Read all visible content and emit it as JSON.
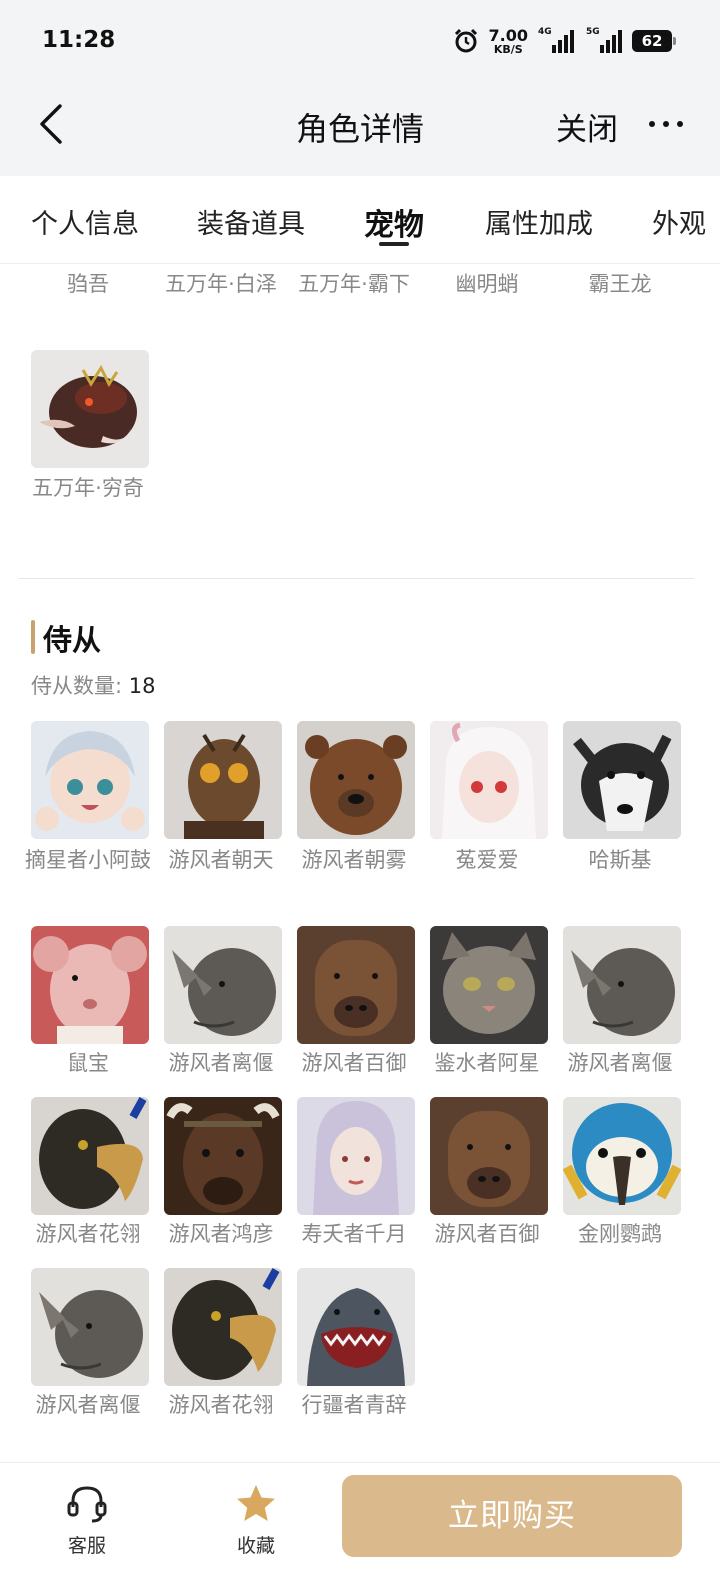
{
  "status_bar": {
    "time": "11:28",
    "net_speed": "7.00",
    "net_unit": "KB/S",
    "sim1": "4G",
    "sim2": "5G",
    "battery": "62"
  },
  "nav": {
    "title": "角色详情",
    "close": "关闭"
  },
  "tabs": [
    {
      "label": "个人信息"
    },
    {
      "label": "装备道具"
    },
    {
      "label": "宠物",
      "active": true
    },
    {
      "label": "属性加成"
    },
    {
      "label": "外观"
    }
  ],
  "pets": {
    "top_row": [
      "驺吾",
      "五万年·白泽",
      "五万年·霸下",
      "幽明蛸",
      "霸王龙"
    ],
    "last": {
      "name": "五万年·穷奇",
      "icon": "qiongqi-avatar"
    }
  },
  "servants": {
    "title": "侍从",
    "count_label": "侍从数量:",
    "count": "18",
    "items": [
      {
        "name": "摘星者小阿鼓",
        "icon": "chibi-girl-avatar",
        "color": "#cfd8e4"
      },
      {
        "name": "游风者朝天",
        "icon": "insect-man-avatar",
        "color": "#6b4a2e"
      },
      {
        "name": "游风者朝雾",
        "icon": "bear-avatar",
        "color": "#7a4a2a"
      },
      {
        "name": "菟爱爱",
        "icon": "white-hair-girl-avatar",
        "color": "#f1ecee"
      },
      {
        "name": "哈斯基",
        "icon": "husky-avatar",
        "color": "#d8d8d8"
      },
      {
        "name": "鼠宝",
        "icon": "rat-avatar",
        "color": "#e8b7b4"
      },
      {
        "name": "游风者离偃",
        "icon": "rhino-avatar",
        "color": "#5d5a55"
      },
      {
        "name": "游风者百御",
        "icon": "capybara-avatar",
        "color": "#6e4a30"
      },
      {
        "name": "鉴水者阿星",
        "icon": "cat-avatar",
        "color": "#6f6a64"
      },
      {
        "name": "游风者离偃",
        "icon": "rhino-avatar",
        "color": "#5d5a55"
      },
      {
        "name": "游风者花翎",
        "icon": "eagle-avatar",
        "color": "#2e2a24"
      },
      {
        "name": "游风者鸿彦",
        "icon": "bull-avatar",
        "color": "#4a3222"
      },
      {
        "name": "寿夭者千月",
        "icon": "silver-hair-woman-avatar",
        "color": "#d9d4e2"
      },
      {
        "name": "游风者百御",
        "icon": "capybara-avatar",
        "color": "#6e4a30"
      },
      {
        "name": "金刚鹦鹉",
        "icon": "macaw-avatar",
        "color": "#2b8bc2"
      },
      {
        "name": "游风者离偃",
        "icon": "rhino-avatar",
        "color": "#5d5a55"
      },
      {
        "name": "游风者花翎",
        "icon": "eagle-avatar",
        "color": "#2e2a24"
      },
      {
        "name": "行疆者青辞",
        "icon": "shark-avatar",
        "color": "#4d5560"
      }
    ]
  },
  "bottom_bar": {
    "service": "客服",
    "favorite": "收藏",
    "buy": "立即购买",
    "accent": "#dab98c"
  }
}
